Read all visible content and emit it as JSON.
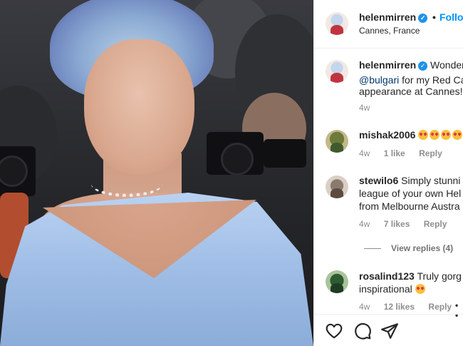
{
  "post": {
    "username": "helenmirren",
    "verified": true,
    "follow_label": "Follow",
    "separator": "•",
    "location": "Cannes, France",
    "caption": {
      "username": "helenmirren",
      "text_line1": "Wonder",
      "mention": "@bulgari",
      "text_line2_rest": " for my Red Ca",
      "text_line3": "appearance at Cannes!",
      "time": "4w"
    }
  },
  "comments": [
    {
      "username": "mishak2006",
      "text_line1": "",
      "emoji_count": 4,
      "time": "4w",
      "likes": "1 like",
      "reply_label": "Reply"
    },
    {
      "username": "stewilo6",
      "text_line1": "Simply stunni",
      "text_line2": "league of your own Hel",
      "text_line3": "from Melbourne Austra",
      "time": "4w",
      "likes": "7 likes",
      "reply_label": "Reply",
      "view_replies": "View replies (4)"
    },
    {
      "username": "rosalind123",
      "text_line1": "Truly gorg",
      "text_line2": "inspirational",
      "emoji_count": 1,
      "time": "4w",
      "likes": "12 likes",
      "reply_label": "Reply",
      "more": "• •"
    }
  ],
  "actions": {
    "like_icon": "heart-icon",
    "comment_icon": "comment-bubble-icon",
    "share_icon": "paper-plane-icon"
  },
  "colors": {
    "follow": "#0095f6",
    "verified": "#1f93e8",
    "muted": "#8e8e8e",
    "mention": "#00376b"
  }
}
